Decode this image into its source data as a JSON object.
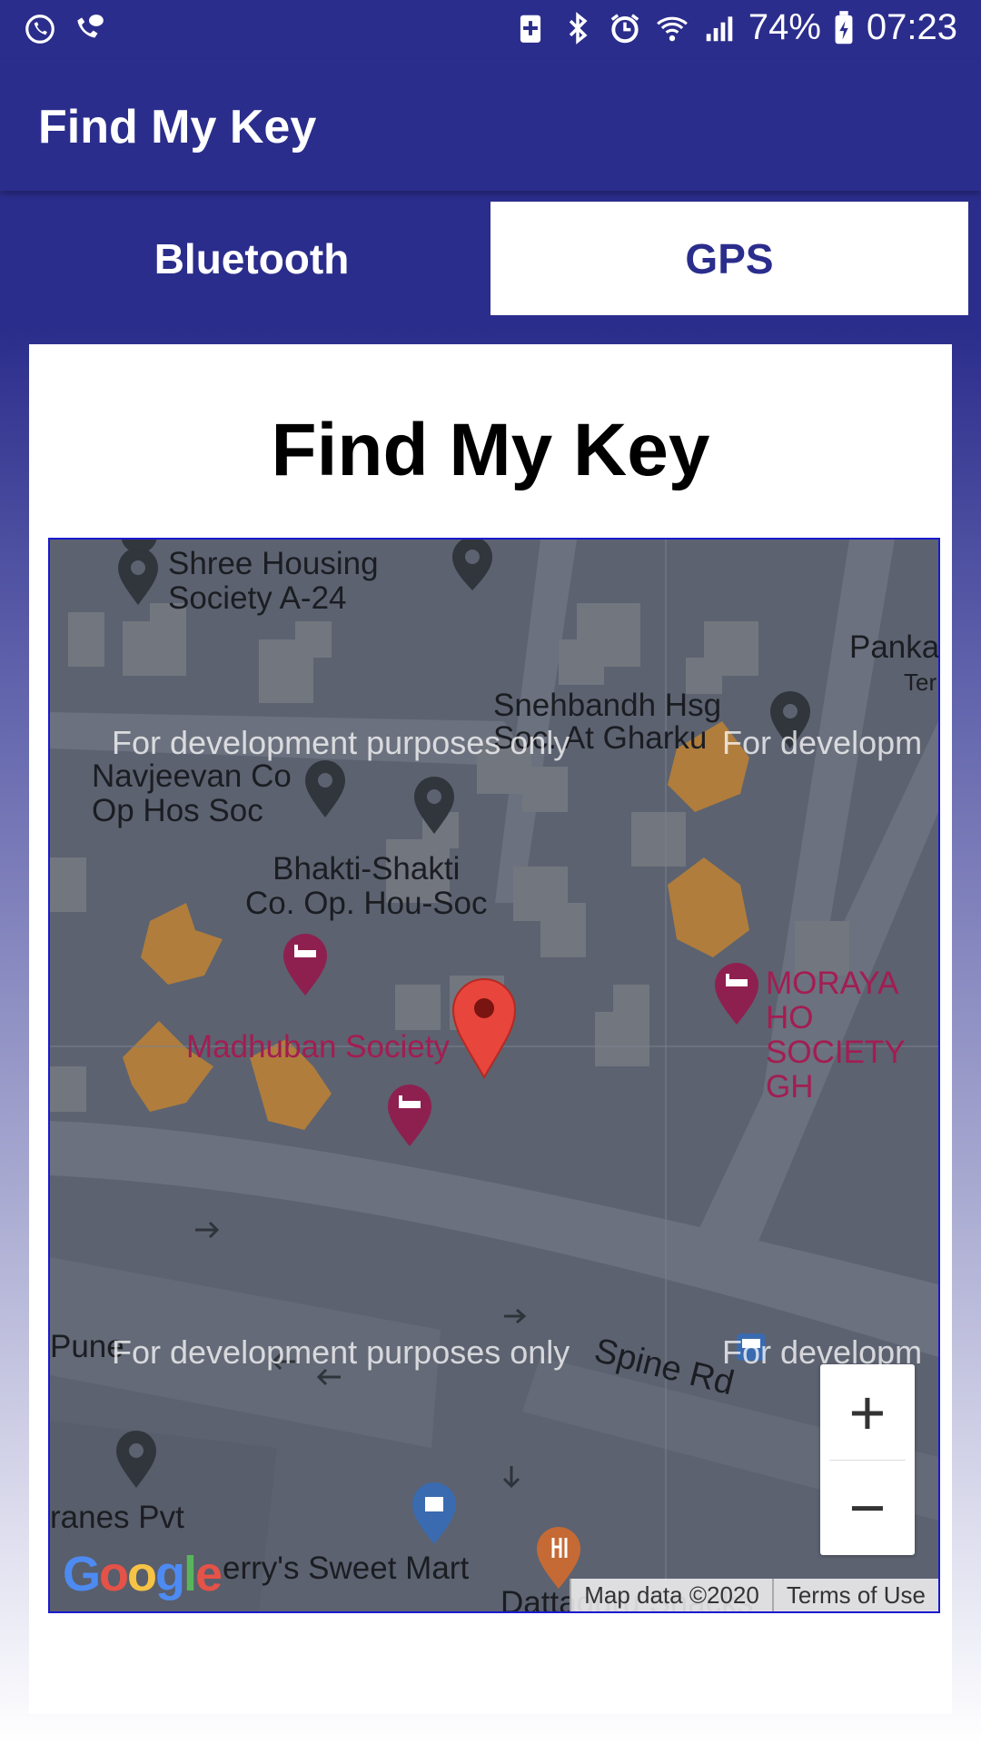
{
  "status_bar": {
    "battery": "74%",
    "time": "07:23",
    "left_icons": [
      "whatsapp-icon",
      "phone-chat-icon"
    ],
    "right_icons": [
      "battery-saver-icon",
      "bluetooth-icon",
      "alarm-icon",
      "wifi-icon",
      "signal-icon",
      "battery-icon"
    ]
  },
  "app_bar": {
    "title": "Find My Key"
  },
  "tabs": [
    {
      "label": "Bluetooth",
      "selected": false
    },
    {
      "label": "GPS",
      "selected": true
    }
  ],
  "content": {
    "title": "Find My Key"
  },
  "map": {
    "watermark": "For development purposes only",
    "watermark_cut": "For developm",
    "places": {
      "shree": "Shree Housing Society A-24",
      "pankaj": "Panka",
      "pankaj2": "Ter",
      "snehbandh": "Snehbandh Hsg",
      "snehbandh2": "Soc. At Gharku",
      "navjeevan": "Navjeevan Co Op Hos Soc",
      "bhakti": "Bhakti-Shakti Co. Op. Hou-Soc",
      "madhuban": "Madhuban Society",
      "moraya": "MORAYA HO SOCIETY GH",
      "pune": "Pune",
      "spine": "Spine Rd",
      "cranes": "ranes Pvt",
      "sweet": "erry's Sweet Mart",
      "dattaguru": "Dattaguru Snacks"
    },
    "zoom_in": "+",
    "zoom_out": "−",
    "attribution": [
      "Map data ©2020",
      "Terms of Use"
    ],
    "logo": "Google"
  }
}
